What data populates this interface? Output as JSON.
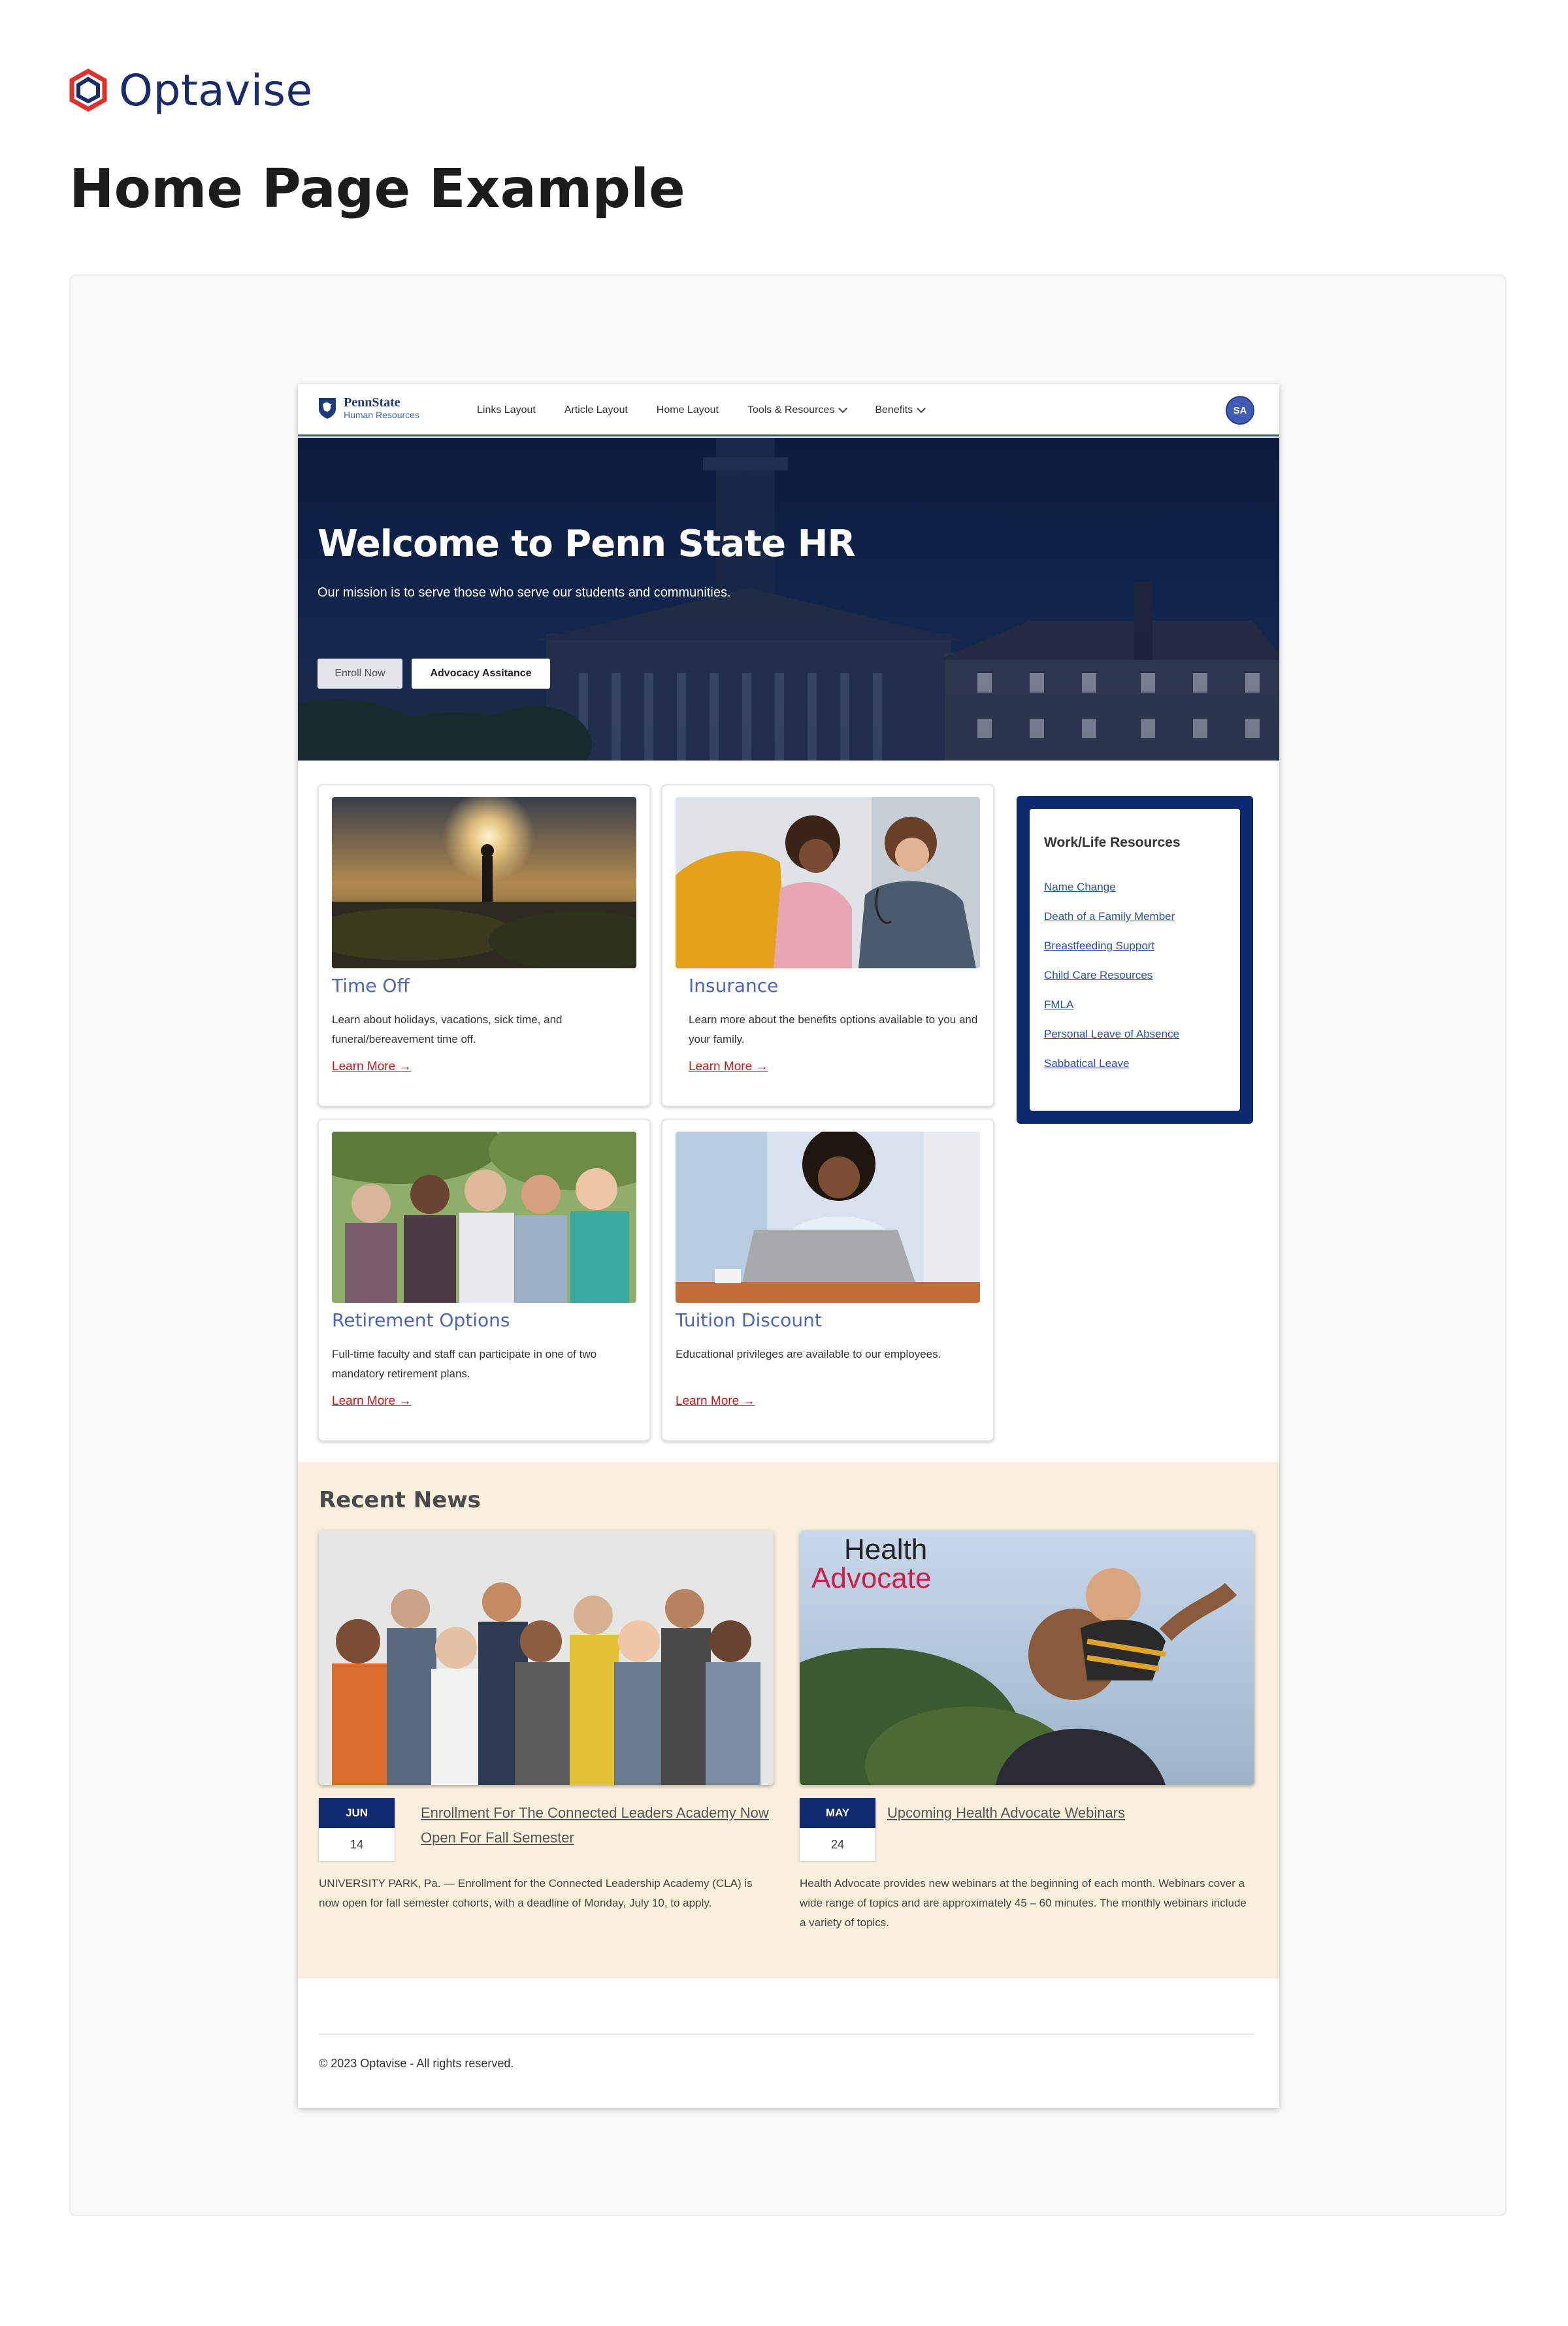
{
  "brand": {
    "name": "Optavise",
    "logo_icon": "optavise-hexagon-icon",
    "colors": {
      "red": "#e0312b",
      "navy": "#1a2b6b"
    }
  },
  "page_heading": "Home Page Example",
  "site": {
    "logo": {
      "main": "PennState",
      "sub": "Human Resources",
      "icon": "penn-state-shield-icon"
    },
    "nav": [
      {
        "label": "Links Layout",
        "dropdown": false
      },
      {
        "label": "Article Layout",
        "dropdown": false
      },
      {
        "label": "Home Layout",
        "dropdown": false
      },
      {
        "label": "Tools & Resources",
        "dropdown": true
      },
      {
        "label": "Benefits",
        "dropdown": true
      }
    ],
    "avatar": "SA",
    "hero": {
      "title": "Welcome to Penn State HR",
      "subtitle": "Our mission is to serve those who serve our students and communities.",
      "buttons": {
        "enroll": "Enroll Now",
        "advocacy": "Advocacy Assitance"
      }
    },
    "cards": [
      {
        "title": "Time Off",
        "desc": "Learn about holidays, vacations, sick time, and funeral/bereavement time off.",
        "link": "Learn More →",
        "image": "sunset-person-photo"
      },
      {
        "title": "Insurance",
        "desc": "Learn more about the benefits options available to you and your family.",
        "link": "Learn More →",
        "image": "doctor-child-photo"
      },
      {
        "title": "Retirement Options",
        "desc": "Full-time faculty and staff can participate in one of two mandatory retirement plans.",
        "link": "Learn More →",
        "image": "seniors-group-photo"
      },
      {
        "title": "Tuition Discount",
        "desc": "Educational privileges are available to our employees.",
        "link": "Learn More →",
        "image": "student-laptop-photo"
      }
    ],
    "sidebar": {
      "title": "Work/Life Resources",
      "links": [
        "Name Change",
        "Death of a Family Member",
        "Breastfeeding Support",
        "Child Care Resources",
        "FMLA",
        "Personal Leave of Absence",
        "Sabbatical Leave"
      ]
    },
    "news": {
      "heading": "Recent News",
      "items": [
        {
          "month": "JUN",
          "day": "14",
          "title": "Enrollment For The Connected Leaders Academy Now Open For Fall Semester",
          "body": "UNIVERSITY PARK, Pa. — Enrollment for the Connected Leadership Academy (CLA) is now open for fall semester cohorts, with a deadline of Monday, July 10, to apply.",
          "image": "group-people-photo"
        },
        {
          "month": "MAY",
          "day": "24",
          "title": "Upcoming Health Advocate Webinars",
          "body": "Health Advocate provides new webinars at the beginning of each month. Webinars cover a wide range of topics and are approximately 45 – 60 minutes. The monthly webinars include a variety of topics.",
          "image": "father-child-photo",
          "image_text": {
            "line1": "Health",
            "line2": "Advocate"
          }
        }
      ]
    },
    "footer": "© 2023 Optavise - All rights reserved."
  }
}
